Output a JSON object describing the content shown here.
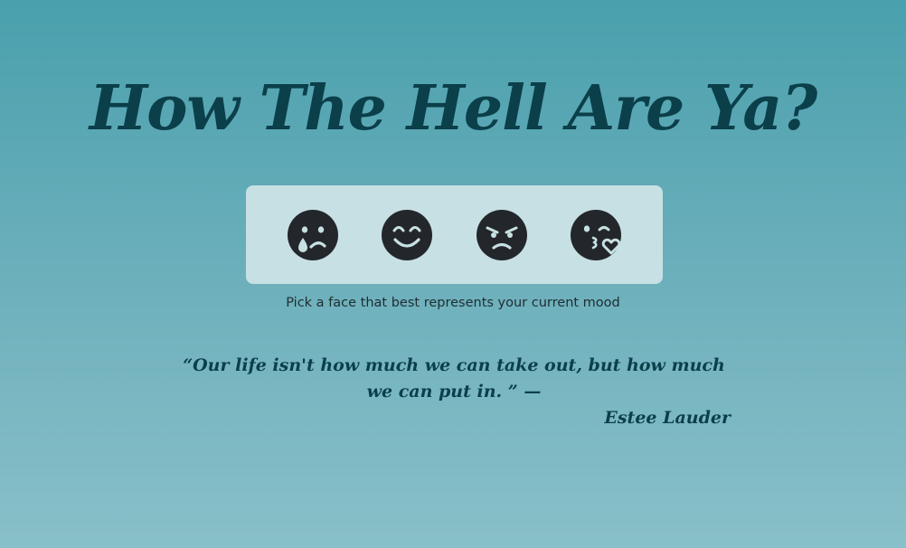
{
  "header": {
    "title": "How The Hell Are Ya?"
  },
  "faces": [
    {
      "name": "crying",
      "icon": "sad-tear-face-icon"
    },
    {
      "name": "happy",
      "icon": "smile-beam-face-icon"
    },
    {
      "name": "angry",
      "icon": "angry-face-icon"
    },
    {
      "name": "kissing",
      "icon": "kiss-wink-heart-face-icon"
    }
  ],
  "prompt": "Pick a face that best represents your current mood",
  "quote": {
    "text": "“Our life isn't how much we can take out, but how much we can put in. ” —",
    "author": "Estee Lauder"
  },
  "colors": {
    "background_top": "#4aa0ad",
    "background_bottom": "#89c0c9",
    "title": "#0b3f4a",
    "panel": "#c7e0e4",
    "icon": "#23272b"
  }
}
